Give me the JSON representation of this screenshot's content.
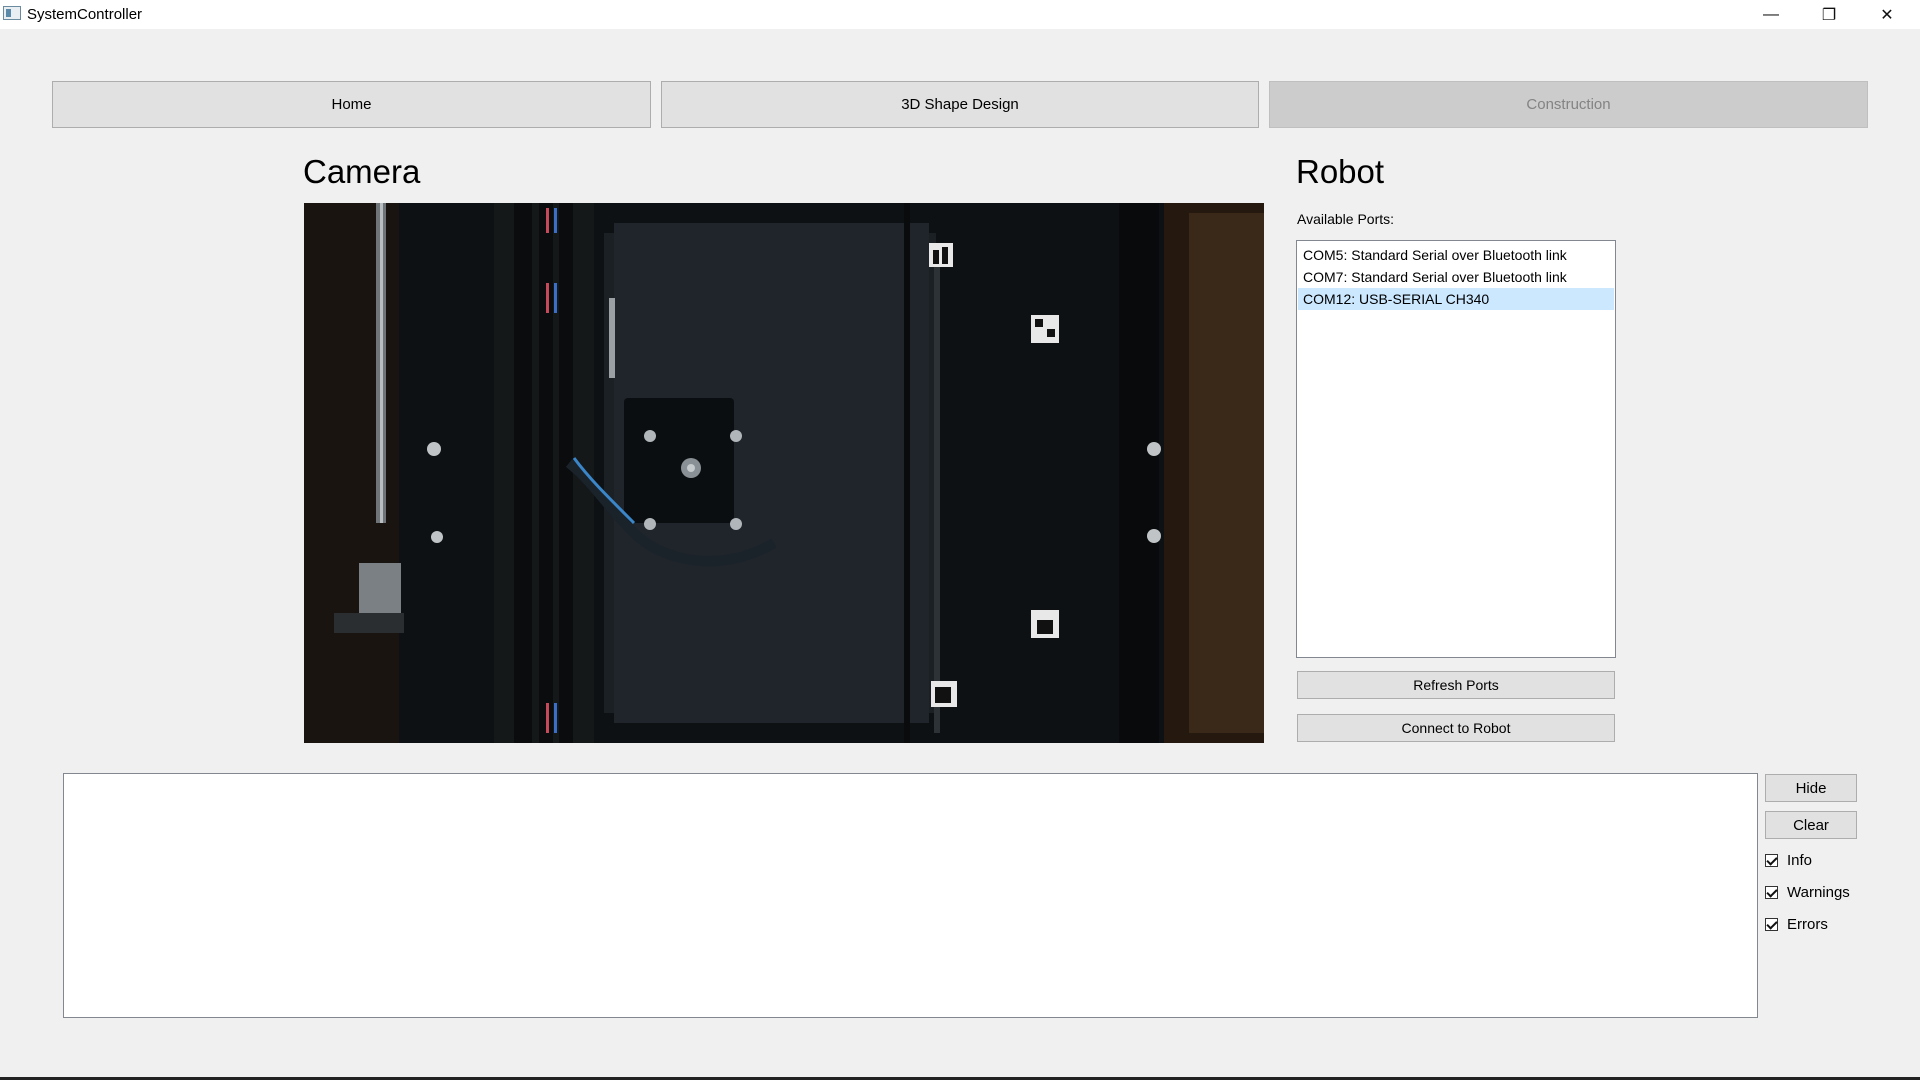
{
  "window": {
    "title": "SystemController",
    "minimize_glyph": "—",
    "maximize_glyph": "❐",
    "close_glyph": "✕"
  },
  "tabs": [
    {
      "label": "Home",
      "enabled": true
    },
    {
      "label": "3D Shape Design",
      "enabled": true
    },
    {
      "label": "Construction",
      "enabled": false
    }
  ],
  "camera": {
    "heading": "Camera"
  },
  "robot": {
    "heading": "Robot",
    "ports_label": "Available Ports:",
    "ports": [
      {
        "label": "COM5: Standard Serial over Bluetooth link",
        "selected": false
      },
      {
        "label": "COM7: Standard Serial over Bluetooth link",
        "selected": false
      },
      {
        "label": "COM12: USB-SERIAL CH340",
        "selected": true
      }
    ],
    "refresh_label": "Refresh Ports",
    "connect_label": "Connect to Robot"
  },
  "log": {
    "hide_label": "Hide",
    "clear_label": "Clear",
    "filters": [
      {
        "label": "Info",
        "checked": true
      },
      {
        "label": "Warnings",
        "checked": true
      },
      {
        "label": "Errors",
        "checked": true
      }
    ]
  },
  "colors": {
    "selection": "#cce8ff",
    "background": "#f0f0f0",
    "button": "#e1e1e1"
  }
}
